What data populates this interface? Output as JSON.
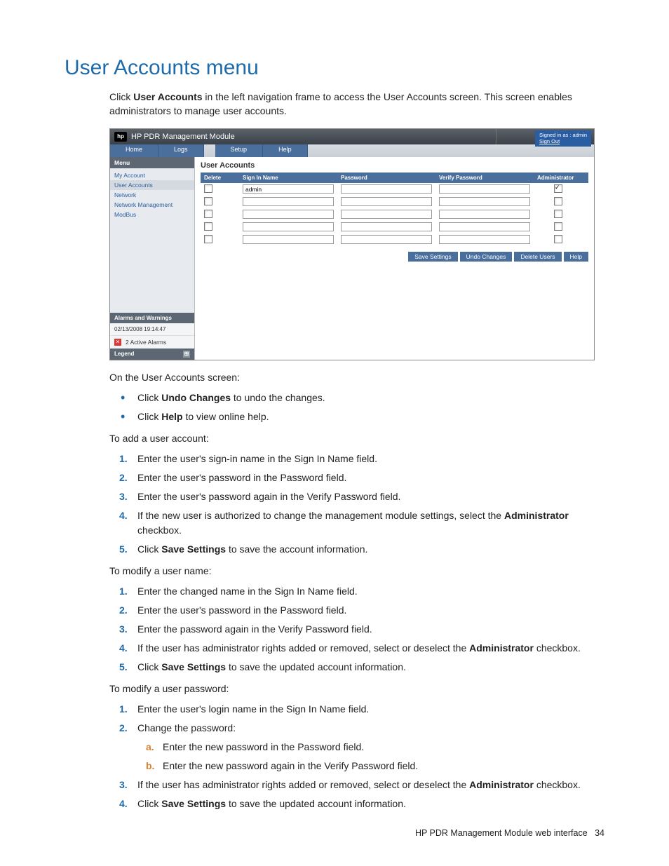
{
  "heading": "User Accounts menu",
  "intro_before": "Click ",
  "intro_bold": "User Accounts",
  "intro_after": " in the left navigation frame to access the User Accounts screen. This screen enables administrators to manage user accounts.",
  "app": {
    "title": "HP PDR Management Module",
    "signed_in": "Signed in as : admin",
    "sign_out": "Sign Out",
    "tabs": {
      "home": "Home",
      "logs": "Logs",
      "setup": "Setup",
      "help": "Help"
    },
    "menu_header": "Menu",
    "menu": [
      "My Account",
      "User Accounts",
      "Network",
      "Network Management",
      "ModBus"
    ],
    "alarms_header": "Alarms and Warnings",
    "timestamp": "02/13/2008 19:14:47",
    "active_alarms": "2 Active Alarms",
    "legend_header": "Legend",
    "content_title": "User Accounts",
    "cols": {
      "delete": "Delete",
      "signin": "Sign In Name",
      "password": "Password",
      "verify": "Verify Password",
      "admin": "Administrator"
    },
    "rows": [
      {
        "signin": "admin",
        "admin_checked": true
      },
      {
        "signin": "",
        "admin_checked": false
      },
      {
        "signin": "",
        "admin_checked": false
      },
      {
        "signin": "",
        "admin_checked": false
      },
      {
        "signin": "",
        "admin_checked": false
      }
    ],
    "buttons": {
      "save": "Save Settings",
      "undo": "Undo Changes",
      "delete": "Delete Users",
      "help": "Help"
    }
  },
  "on_screen": "On the User Accounts screen:",
  "bullets": {
    "undo_pre": "Click ",
    "undo_b": "Undo Changes",
    "undo_post": " to undo the changes.",
    "help_pre": "Click ",
    "help_b": "Help",
    "help_post": " to view online help."
  },
  "add_title": "To add a user account:",
  "add": [
    "Enter the user's sign-in name in the Sign In Name field.",
    "Enter the user's password in the Password field.",
    "Enter the user's password again in the Verify Password field."
  ],
  "add4_pre": "If the new user is authorized to change the management module settings, select the ",
  "add4_b": "Administrator",
  "add4_post": " checkbox.",
  "add5_pre": "Click ",
  "add5_b": "Save Settings",
  "add5_post": " to save the account information.",
  "modname_title": "To modify a user name:",
  "modname": [
    "Enter the changed name in the Sign In Name field.",
    "Enter the user's password in the Password field.",
    "Enter the password again in the Verify Password field."
  ],
  "modname4_pre": "If the user has administrator rights added or removed, select or deselect the ",
  "modname4_b": "Administrator",
  "modname4_post": " checkbox.",
  "modname5_pre": "Click ",
  "modname5_b": "Save Settings",
  "modname5_post": " to save the updated account information.",
  "modpw_title": "To modify a user password:",
  "modpw1": "Enter the user's login name in the Sign In Name field.",
  "modpw2": "Change the password:",
  "modpw2a": "Enter the new password in the Password field.",
  "modpw2b": "Enter the new password again in the Verify Password field.",
  "modpw3_pre": "If the user has administrator rights added or removed, select or deselect the ",
  "modpw3_b": "Administrator",
  "modpw3_post": " checkbox.",
  "modpw4_pre": "Click ",
  "modpw4_b": "Save Settings",
  "modpw4_post": " to save the updated account information.",
  "footer_text": "HP PDR Management Module web interface",
  "footer_page": "34"
}
